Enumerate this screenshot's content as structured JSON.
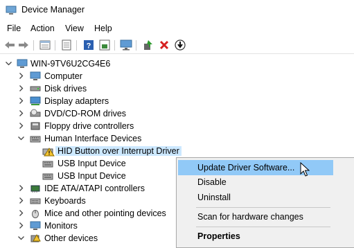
{
  "window": {
    "title": "Device Manager"
  },
  "menu": [
    "File",
    "Action",
    "View",
    "Help"
  ],
  "toolbar": {
    "buttons": [
      "back-icon",
      "forward-icon",
      "properties-icon",
      "view-icon",
      "help-icon",
      "view-toggle-icon",
      "monitor-icon",
      "update-driver-icon",
      "uninstall-icon",
      "download-icon"
    ]
  },
  "tree": {
    "root": "WIN-9TV6U2CG4E6",
    "items": [
      "Computer",
      "Disk drives",
      "Display adapters",
      "DVD/CD-ROM drives",
      "Floppy drive controllers",
      "Human Interface Devices",
      "HID Button over Interrupt Driver",
      "USB Input Device",
      "USB Input Device",
      "IDE ATA/ATAPI controllers",
      "Keyboards",
      "Mice and other pointing devices",
      "Monitors",
      "Other devices"
    ]
  },
  "context_menu": {
    "items": [
      "Update Driver Software...",
      "Disable",
      "Uninstall",
      "Scan for hardware changes",
      "Properties"
    ]
  },
  "colors": {
    "selection": "#cce8ff",
    "menu_highlight": "#91c9f7",
    "uninstall_red": "#d62020",
    "warning_yellow": "#f4c430"
  }
}
